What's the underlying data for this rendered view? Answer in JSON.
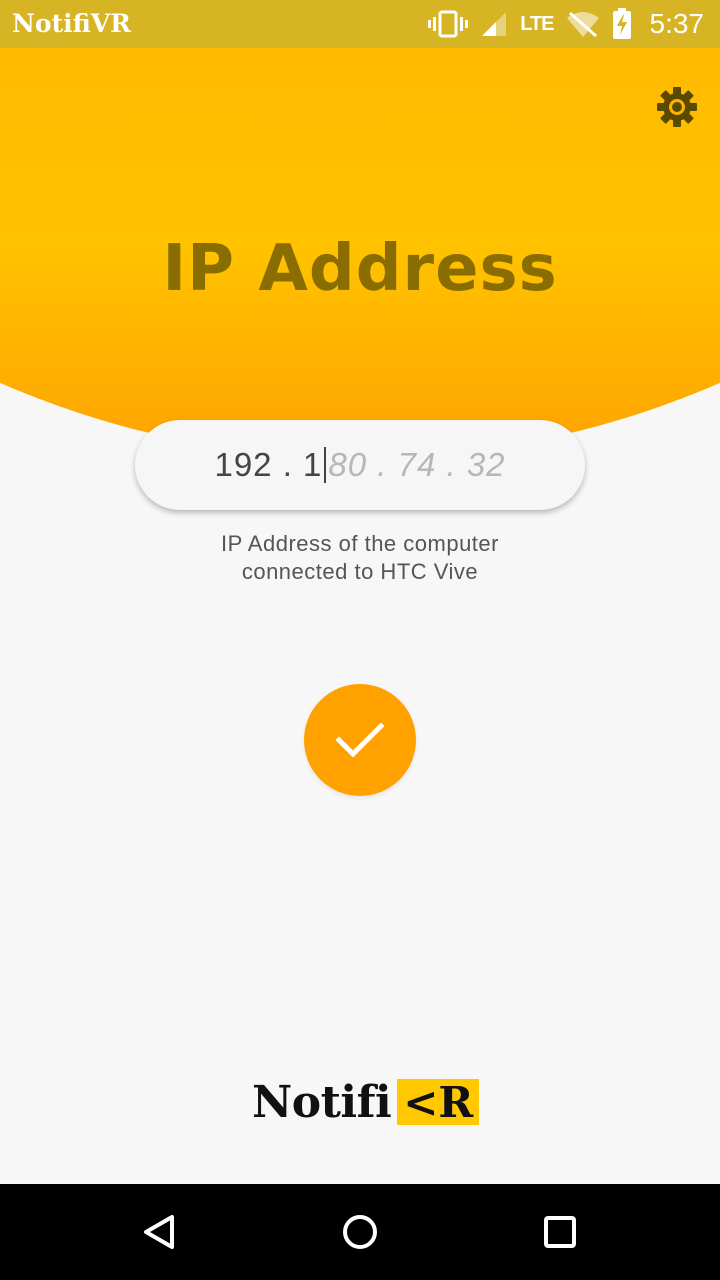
{
  "status_bar": {
    "app_name": "NotifiVR",
    "network": "LTE",
    "time": "5:37",
    "icons": [
      "vibrate-icon",
      "signal-icon",
      "wifi-off-icon",
      "battery-charging-icon"
    ]
  },
  "header": {
    "title": "IP Address",
    "settings_icon": "gear-icon"
  },
  "ip_input": {
    "entered_value": "192 . 1",
    "hint_remainder": "80 . 74 . 32"
  },
  "helper_text": {
    "line1": "IP Address of the computer",
    "line2": "connected to HTC Vive"
  },
  "confirm_button": {
    "icon": "check-icon"
  },
  "logo": {
    "text": "Notifi",
    "badge_glyph": "<",
    "badge_letter": "R"
  },
  "navigation": {
    "back": "back-icon",
    "home": "home-icon",
    "recents": "recents-icon"
  },
  "colors": {
    "accent": "#ffa200",
    "header_yellow": "#ffc300",
    "title_text": "#8a6d00",
    "status_bar": "#d6b424"
  }
}
